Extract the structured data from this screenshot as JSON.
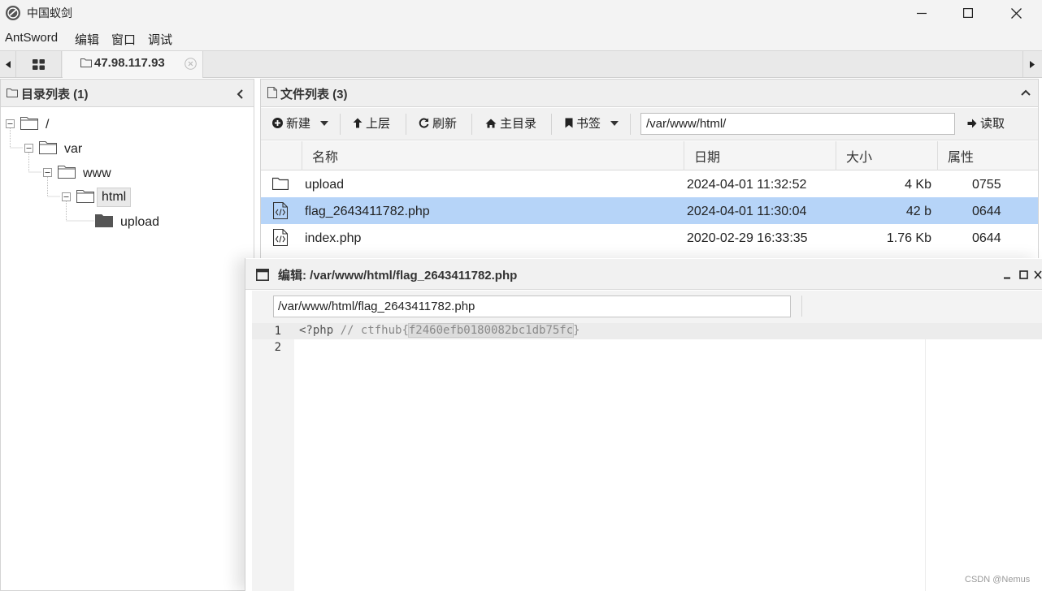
{
  "window": {
    "title": "中国蚁剑",
    "controls": [
      "minimize",
      "maximize",
      "close"
    ]
  },
  "menu": {
    "items": [
      "AntSword",
      "编辑",
      "窗口",
      "调试"
    ]
  },
  "tabs": {
    "host_label": "47.98.117.93"
  },
  "left_panel": {
    "title": "目录列表 (1)",
    "tree": [
      {
        "label": "/",
        "depth": 0
      },
      {
        "label": "var",
        "depth": 1
      },
      {
        "label": "www",
        "depth": 2
      },
      {
        "label": "html",
        "depth": 3,
        "selected": true
      },
      {
        "label": "upload",
        "depth": 4
      }
    ]
  },
  "right_panel": {
    "title": "文件列表 (3)",
    "toolbar": {
      "new_label": "新建",
      "up_label": "上层",
      "refresh_label": "刷新",
      "home_label": "主目录",
      "bookmark_label": "书签",
      "path_value": "/var/www/html/",
      "read_label": "读取"
    },
    "columns": [
      "名称",
      "日期",
      "大小",
      "属性"
    ],
    "files": [
      {
        "name": "upload",
        "date": "2024-04-01 11:32:52",
        "size": "4 Kb",
        "perm": "0755",
        "type": "folder"
      },
      {
        "name": "flag_2643411782.php",
        "date": "2024-04-01 11:30:04",
        "size": "42 b",
        "perm": "0644",
        "type": "code",
        "selected": true
      },
      {
        "name": "index.php",
        "date": "2020-02-29 16:33:35",
        "size": "1.76 Kb",
        "perm": "0644",
        "type": "code"
      }
    ]
  },
  "editor": {
    "title": "编辑: /var/www/html/flag_2643411782.php",
    "path_value": "/var/www/html/flag_2643411782.php",
    "line_numbers": [
      "1",
      "2"
    ],
    "code_line1_prefix": "<?php",
    "code_line1_comment": " // ctfhub{",
    "code_line1_selected": "f2460efb0180082bc1db75fc",
    "code_line1_suffix": "}"
  },
  "watermark": "CSDN @Nemus",
  "colors": {
    "selected_row": "#b6d4f8",
    "chrome_bg": "#f3f3f3",
    "header_bg": "#efefef"
  }
}
